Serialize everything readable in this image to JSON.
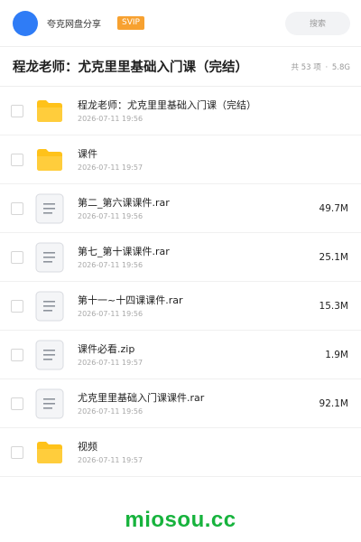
{
  "header": {
    "app_name": "夸克网盘分享",
    "badge": "SVIP",
    "search_label": "搜索",
    "avatar_color": "#2f7cf6",
    "badge_color": "#f7a130"
  },
  "folder": {
    "title": "程龙老师：尤克里里基础入门课（完结）",
    "count": "共 53 项",
    "separator": "·",
    "size": "5.8G"
  },
  "files": [
    {
      "type": "folder-icon",
      "name": "程龙老师：尤克里里基础入门课（完结）",
      "date": "2026-07-11 19:56",
      "size": ""
    },
    {
      "type": "folder-icon",
      "name": "课件",
      "date": "2026-07-11 19:57",
      "size": ""
    },
    {
      "type": "archive-icon",
      "name": "第二_第六课课件.rar",
      "date": "2026-07-11 19:56",
      "size": "49.7M"
    },
    {
      "type": "archive-icon",
      "name": "第七_第十课课件.rar",
      "date": "2026-07-11 19:56",
      "size": "25.1M"
    },
    {
      "type": "archive-icon",
      "name": "第十一~十四课课件.rar",
      "date": "2026-07-11 19:56",
      "size": "15.3M"
    },
    {
      "type": "archive-icon",
      "name": "课件必看.zip",
      "date": "2026-07-11 19:57",
      "size": "1.9M"
    },
    {
      "type": "archive-icon",
      "name": "尤克里里基础入门课课件.rar",
      "date": "2026-07-11 19:56",
      "size": "92.1M"
    },
    {
      "type": "folder-icon",
      "name": "视频",
      "date": "2026-07-11 19:57",
      "size": ""
    }
  ],
  "watermark": "miosou.cc",
  "colors": {
    "folder_yellow": "#ffc21a",
    "watermark_green": "#17b33d"
  }
}
